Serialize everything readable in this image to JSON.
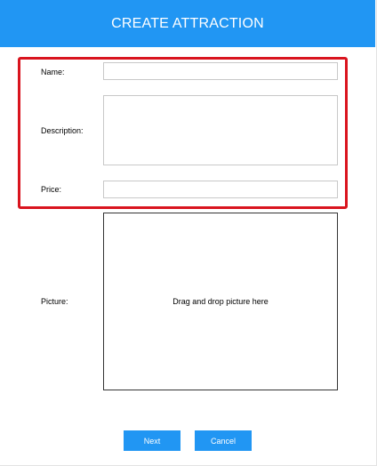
{
  "header": {
    "title": "CREATE ATTRACTION",
    "background": "#2196f3"
  },
  "form": {
    "name": {
      "label": "Name:",
      "value": ""
    },
    "description": {
      "label": "Description:",
      "value": ""
    },
    "price": {
      "label": "Price:",
      "value": ""
    },
    "picture": {
      "label": "Picture:",
      "drop_text": "Drag and drop picture here"
    }
  },
  "buttons": {
    "next": "Next",
    "cancel": "Cancel"
  },
  "highlight": {
    "color": "#d9141e"
  }
}
